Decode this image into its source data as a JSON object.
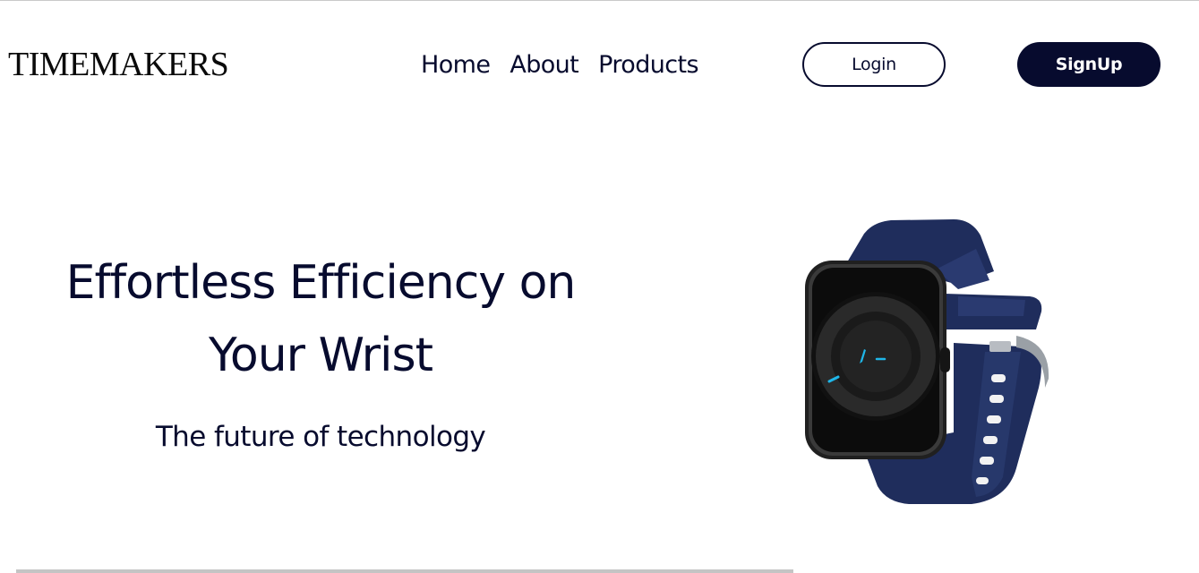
{
  "brand": {
    "name": "TIMEMAKERS"
  },
  "nav": {
    "items": [
      {
        "label": "Home"
      },
      {
        "label": "About"
      },
      {
        "label": "Products"
      }
    ]
  },
  "auth": {
    "login_label": "Login",
    "signup_label": "SignUp"
  },
  "hero": {
    "title_line1": "Effortless Efficiency on",
    "title_line2": "Your Wrist",
    "subtitle": "The future of technology"
  },
  "colors": {
    "primary": "#070b2e",
    "background": "#ffffff",
    "strap": "#1f2d5c",
    "accent": "#1fb6e8"
  },
  "icons": {
    "product_image": "smartwatch-image"
  }
}
